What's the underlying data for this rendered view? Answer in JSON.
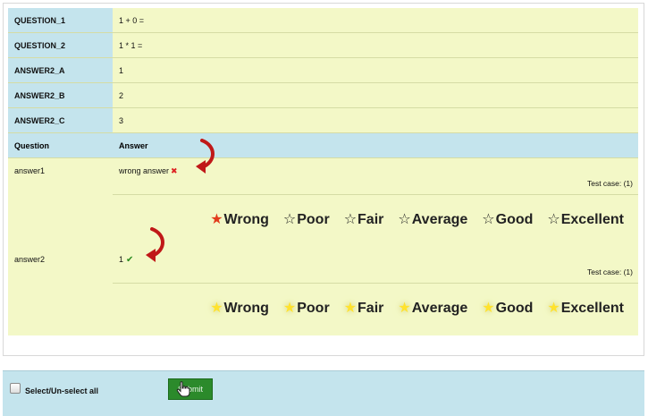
{
  "fields": [
    {
      "label": "QUESTION_1",
      "value": "1 + 0 ="
    },
    {
      "label": "QUESTION_2",
      "value": "1 * 1 ="
    },
    {
      "label": "ANSWER2_A",
      "value": "1"
    },
    {
      "label": "ANSWER2_B",
      "value": "2"
    },
    {
      "label": "ANSWER2_C",
      "value": "3"
    }
  ],
  "table_header": {
    "question": "Question",
    "answer": "Answer"
  },
  "answers": [
    {
      "name": "answer1",
      "response": "wrong answer",
      "result": "incorrect",
      "test_case": "Test case: (1)",
      "selected_rating": "Wrong"
    },
    {
      "name": "answer2",
      "response": "1",
      "result": "correct",
      "test_case": "Test case: (1)",
      "selected_rating": ""
    }
  ],
  "rating_options": [
    "Wrong",
    "Poor",
    "Fair",
    "Average",
    "Good",
    "Excellent"
  ],
  "footer": {
    "select_all_label": "Select/Un-select all",
    "submit_label": "Submit"
  },
  "colors": {
    "label_bg": "#c4e4ed",
    "value_bg": "#f3f8c7",
    "submit_bg": "#2b8a2b",
    "selected_star": "#e23c1c",
    "glow_star": "#ffe22e",
    "arrow": "#c01818"
  }
}
